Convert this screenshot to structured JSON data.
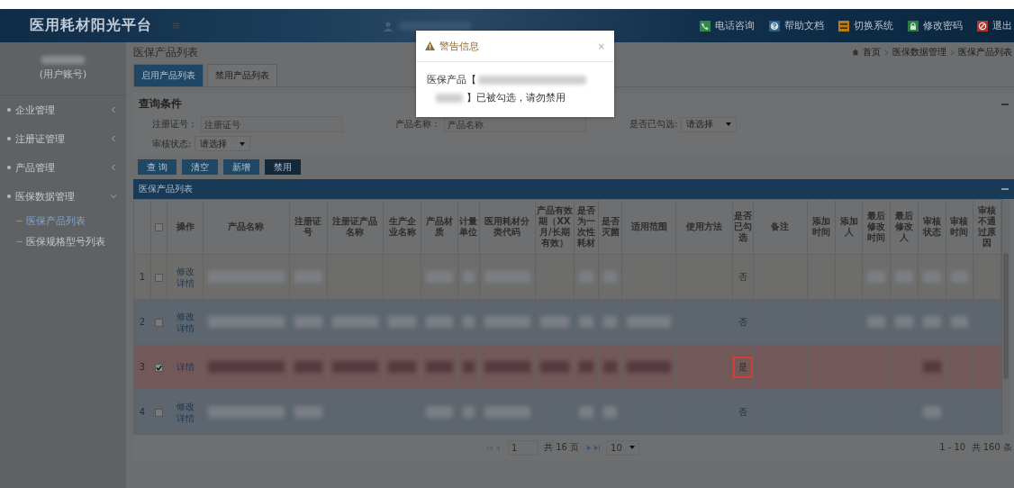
{
  "header": {
    "logo": "医用耗材阳光平台",
    "actions": [
      {
        "kind": "phone",
        "label": "电话咨询"
      },
      {
        "kind": "help",
        "label": "帮助文档"
      },
      {
        "kind": "switch",
        "label": "切换系统"
      },
      {
        "kind": "lock",
        "label": "修改密码"
      },
      {
        "kind": "exit",
        "label": "退出"
      }
    ]
  },
  "sidebar": {
    "account": "(用户账号)",
    "items": [
      {
        "label": "企业管理",
        "expanded": false
      },
      {
        "label": "注册证管理",
        "expanded": false
      },
      {
        "label": "产品管理",
        "expanded": false
      },
      {
        "label": "医保数据管理",
        "expanded": true,
        "children": [
          {
            "label": "医保产品列表",
            "selected": true
          },
          {
            "label": "医保规格型号列表",
            "selected": false
          }
        ]
      }
    ]
  },
  "page": {
    "title": "医保产品列表",
    "breadcrumb": [
      "首页",
      "医保数据管理",
      "医保产品列表"
    ],
    "tabs": [
      {
        "label": "启用产品列表",
        "selected": true
      },
      {
        "label": "禁用产品列表",
        "selected": false
      }
    ],
    "query": {
      "title": "查询条件",
      "fields": [
        {
          "kind": "input",
          "label": "注册证号：",
          "placeholder": "注册证号"
        },
        {
          "kind": "input",
          "label": "产品名称：",
          "placeholder": "产品名称"
        },
        {
          "kind": "select",
          "label": "是否已勾选:",
          "value": "请选择"
        },
        {
          "kind": "select",
          "label": "审核状态:",
          "value": "请选择"
        }
      ],
      "buttons": [
        {
          "label": "查 询",
          "kind": "normal"
        },
        {
          "label": "清空",
          "kind": "normal"
        },
        {
          "label": "新增",
          "kind": "normal"
        },
        {
          "label": "禁用",
          "kind": "dark"
        }
      ]
    },
    "table": {
      "title": "医保产品列表",
      "header_checked": false,
      "columns": [
        "操作",
        "产品名称",
        "注册证号",
        "注册证产品名称",
        "生产企业名称",
        "产品材质",
        "计量单位",
        "医用耗材分类代码",
        "产品有效期（XX月/长期有效）",
        "是否为一次性耗材",
        "是否灭菌",
        "适用范围",
        "使用方法",
        "是否已勾选",
        "备注",
        "添加时间",
        "添加人",
        "最后修改时间",
        "最后修改人",
        "审核状态",
        "审核时间",
        "审核不通过原因"
      ],
      "rows": [
        {
          "number": "1",
          "checked": false,
          "selected": false,
          "cells": [
            {
              "kind": "links",
              "links": [
                "修改",
                "详情"
              ]
            },
            {
              "kind": "blurred"
            },
            {
              "kind": "blurred"
            },
            {
              "kind": "blank"
            },
            {
              "kind": "blank"
            },
            {
              "kind": "blurred"
            },
            {
              "kind": "blurred"
            },
            {
              "kind": "blurred"
            },
            {
              "kind": "blank"
            },
            {
              "kind": "blurred"
            },
            {
              "kind": "blurred"
            },
            {
              "kind": "blank"
            },
            {
              "kind": "blank"
            },
            {
              "kind": "text",
              "text": "否",
              "highlighted": false
            },
            {
              "kind": "blank"
            },
            {
              "kind": "blank"
            },
            {
              "kind": "blank"
            },
            {
              "kind": "blurred"
            },
            {
              "kind": "blurred"
            },
            {
              "kind": "blurred"
            },
            {
              "kind": "blurred"
            },
            {
              "kind": "blank"
            }
          ]
        },
        {
          "number": "2",
          "checked": false,
          "selected": false,
          "cells": [
            {
              "kind": "links",
              "links": [
                "修改",
                "详情"
              ]
            },
            {
              "kind": "blurred"
            },
            {
              "kind": "blurred"
            },
            {
              "kind": "blurred"
            },
            {
              "kind": "blurred"
            },
            {
              "kind": "blurred"
            },
            {
              "kind": "blurred"
            },
            {
              "kind": "blurred"
            },
            {
              "kind": "blurred"
            },
            {
              "kind": "blurred"
            },
            {
              "kind": "blurred"
            },
            {
              "kind": "blurred"
            },
            {
              "kind": "blank"
            },
            {
              "kind": "text",
              "text": "否",
              "highlighted": false
            },
            {
              "kind": "blank"
            },
            {
              "kind": "blank"
            },
            {
              "kind": "blank"
            },
            {
              "kind": "blurred"
            },
            {
              "kind": "blurred"
            },
            {
              "kind": "blurred"
            },
            {
              "kind": "blurred"
            },
            {
              "kind": "blank"
            }
          ]
        },
        {
          "number": "3",
          "checked": true,
          "selected": true,
          "cells": [
            {
              "kind": "links",
              "links": [
                "详情"
              ]
            },
            {
              "kind": "blurred"
            },
            {
              "kind": "blurred"
            },
            {
              "kind": "blurred"
            },
            {
              "kind": "blurred"
            },
            {
              "kind": "blurred"
            },
            {
              "kind": "blurred"
            },
            {
              "kind": "blurred"
            },
            {
              "kind": "blurred"
            },
            {
              "kind": "blurred"
            },
            {
              "kind": "blurred"
            },
            {
              "kind": "blurred"
            },
            {
              "kind": "blank"
            },
            {
              "kind": "text",
              "text": "是",
              "highlighted": true
            },
            {
              "kind": "blank"
            },
            {
              "kind": "blank"
            },
            {
              "kind": "blank"
            },
            {
              "kind": "blank"
            },
            {
              "kind": "blank"
            },
            {
              "kind": "blurred"
            },
            {
              "kind": "blank"
            },
            {
              "kind": "blank"
            }
          ]
        },
        {
          "number": "4",
          "checked": false,
          "selected": false,
          "cells": [
            {
              "kind": "links",
              "links": [
                "修改",
                "详情"
              ]
            },
            {
              "kind": "blurred"
            },
            {
              "kind": "blurred"
            },
            {
              "kind": "blank"
            },
            {
              "kind": "blank"
            },
            {
              "kind": "blurred"
            },
            {
              "kind": "blurred"
            },
            {
              "kind": "blurred"
            },
            {
              "kind": "blank"
            },
            {
              "kind": "blurred"
            },
            {
              "kind": "blurred"
            },
            {
              "kind": "blank"
            },
            {
              "kind": "blank"
            },
            {
              "kind": "text",
              "text": "否",
              "highlighted": false
            },
            {
              "kind": "blank"
            },
            {
              "kind": "blank"
            },
            {
              "kind": "blank"
            },
            {
              "kind": "blank"
            },
            {
              "kind": "blank"
            },
            {
              "kind": "blurred"
            },
            {
              "kind": "blank"
            },
            {
              "kind": "blank"
            }
          ]
        }
      ],
      "pagination": {
        "page": "1",
        "pages": "共 16 页",
        "page_size": "10",
        "summary": "1 - 10  共 160 条"
      }
    }
  },
  "modal": {
    "title": "警告信息",
    "close": "×",
    "text_before": "医保产品【",
    "text_after": "】已被勾选，请勿禁用"
  }
}
